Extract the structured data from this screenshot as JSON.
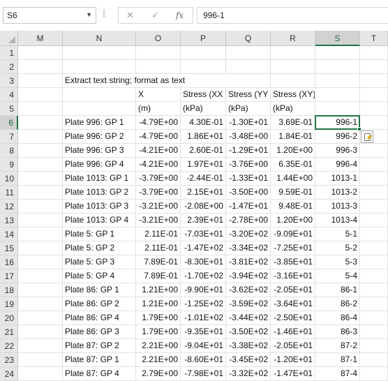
{
  "name_box": "S6",
  "formula_value": "996-1",
  "formula_buttons": {
    "cancel": "✕",
    "enter": "✓",
    "fx": "fx"
  },
  "accent_color": "#217346",
  "selected_cell": "S6",
  "columns": [
    "M",
    "N",
    "O",
    "P",
    "Q",
    "R",
    "S",
    "T"
  ],
  "rows": [
    "1",
    "2",
    "3",
    "4",
    "5",
    "6",
    "7",
    "8",
    "9",
    "10",
    "11",
    "12",
    "13",
    "14",
    "15",
    "16",
    "17",
    "18",
    "19",
    "20",
    "21",
    "22",
    "23",
    "24"
  ],
  "title_cell": "Extract text string; format as text",
  "headers": {
    "O4": "X",
    "P4": "Stress (XX",
    "Q4": "Stress (YY",
    "R4": "Stress (XY)",
    "O5": "(m)",
    "P5": "(kPa)",
    "Q5": "(kPa)",
    "R5": "(kPa)"
  },
  "data_rows": [
    {
      "label": "Plate 996: GP 1",
      "x": "-4.79E+00",
      "sxx": "4.30E-01",
      "syy": "-1.30E+01",
      "sxy": "3.69E-01",
      "id": "996-1"
    },
    {
      "label": "Plate 996: GP 2",
      "x": "-4.79E+00",
      "sxx": "1.86E+01",
      "syy": "-3.48E+00",
      "sxy": "1.84E-01",
      "id": "996-2"
    },
    {
      "label": "Plate 996: GP 3",
      "x": "-4.21E+00",
      "sxx": "2.60E-01",
      "syy": "-1.29E+01",
      "sxy": "1.20E+00",
      "id": "996-3"
    },
    {
      "label": "Plate 996: GP 4",
      "x": "-4.21E+00",
      "sxx": "1.97E+01",
      "syy": "-3.76E+00",
      "sxy": "6.35E-01",
      "id": "996-4"
    },
    {
      "label": "Plate 1013: GP 1",
      "x": "-3.79E+00",
      "sxx": "-2.44E-01",
      "syy": "-1.33E+01",
      "sxy": "1.44E+00",
      "id": "1013-1"
    },
    {
      "label": "Plate 1013: GP 2",
      "x": "-3.79E+00",
      "sxx": "2.15E+01",
      "syy": "-3.50E+00",
      "sxy": "9.59E-01",
      "id": "1013-2"
    },
    {
      "label": "Plate 1013: GP 3",
      "x": "-3.21E+00",
      "sxx": "-2.08E+00",
      "syy": "-1.47E+01",
      "sxy": "9.48E-01",
      "id": "1013-3"
    },
    {
      "label": "Plate 1013: GP 4",
      "x": "-3.21E+00",
      "sxx": "2.39E+01",
      "syy": "-2.78E+00",
      "sxy": "1.20E+00",
      "id": "1013-4"
    },
    {
      "label": "Plate 5: GP 1",
      "x": "2.11E-01",
      "sxx": "-7.03E+01",
      "syy": "-3.20E+02",
      "sxy": "-9.09E+01",
      "id": "5-1"
    },
    {
      "label": "Plate 5: GP 2",
      "x": "2.11E-01",
      "sxx": "-1.47E+02",
      "syy": "-3.34E+02",
      "sxy": "-7.25E+01",
      "id": "5-2"
    },
    {
      "label": "Plate 5: GP 3",
      "x": "7.89E-01",
      "sxx": "-8.30E+01",
      "syy": "-3.81E+02",
      "sxy": "-3.85E+01",
      "id": "5-3"
    },
    {
      "label": "Plate 5: GP 4",
      "x": "7.89E-01",
      "sxx": "-1.70E+02",
      "syy": "-3.94E+02",
      "sxy": "-3.16E+01",
      "id": "5-4"
    },
    {
      "label": "Plate 86: GP 1",
      "x": "1.21E+00",
      "sxx": "-9.90E+01",
      "syy": "-3.62E+02",
      "sxy": "-2.05E+01",
      "id": "86-1"
    },
    {
      "label": "Plate 86: GP 2",
      "x": "1.21E+00",
      "sxx": "-1.25E+02",
      "syy": "-3.59E+02",
      "sxy": "-3.64E+01",
      "id": "86-2"
    },
    {
      "label": "Plate 86: GP 4",
      "x": "1.79E+00",
      "sxx": "-1.01E+02",
      "syy": "-3.44E+02",
      "sxy": "-2.50E+01",
      "id": "86-4"
    },
    {
      "label": "Plate 86: GP 3",
      "x": "1.79E+00",
      "sxx": "-9.35E+01",
      "syy": "-3.50E+02",
      "sxy": "-1.46E+01",
      "id": "86-3"
    },
    {
      "label": "Plate 87: GP 2",
      "x": "2.21E+00",
      "sxx": "-9.04E+01",
      "syy": "-3.38E+02",
      "sxy": "-2.05E+01",
      "id": "87-2"
    },
    {
      "label": "Plate 87: GP 1",
      "x": "2.21E+00",
      "sxx": "-8.60E+01",
      "syy": "-3.45E+02",
      "sxy": "-1.20E+01",
      "id": "87-1"
    },
    {
      "label": "Plate 87: GP 4",
      "x": "2.79E+00",
      "sxx": "-7.98E+01",
      "syy": "-3.32E+02",
      "sxy": "-1.47E+01",
      "id": "87-4"
    }
  ]
}
